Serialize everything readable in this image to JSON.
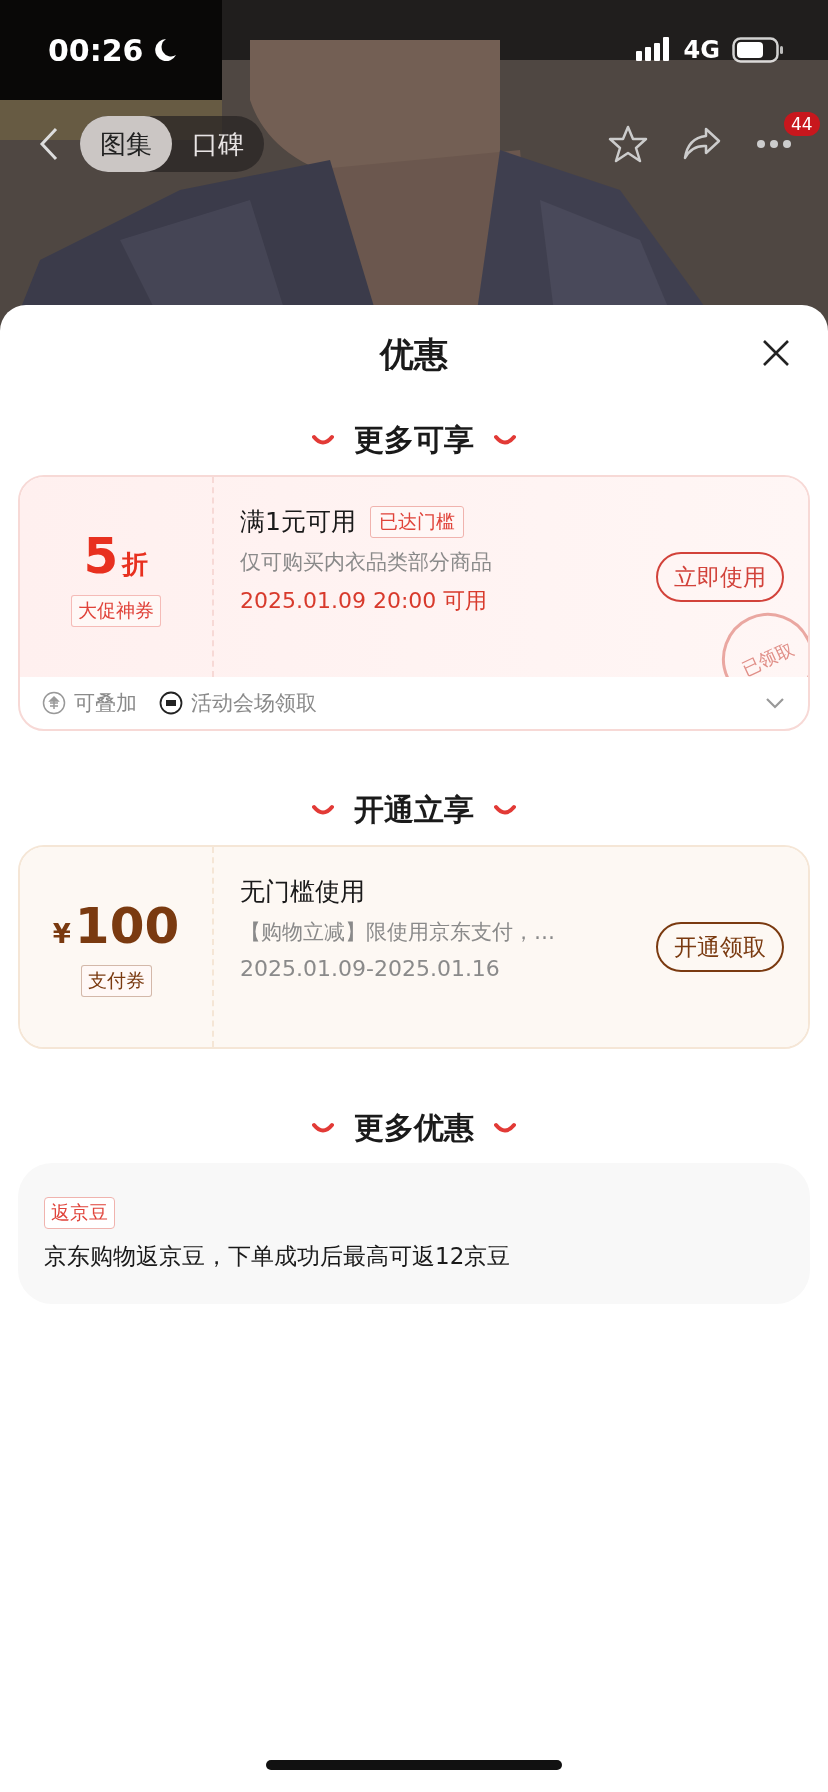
{
  "status_bar": {
    "time": "00:26",
    "network": "4G"
  },
  "nav": {
    "tabs": [
      {
        "label": "图集",
        "selected": true
      },
      {
        "label": "口碑",
        "selected": false
      }
    ],
    "more_badge": "44"
  },
  "sheet": {
    "title": "优惠",
    "sections": [
      {
        "title": "更多可享",
        "coupons": [
          {
            "kind": "discount",
            "amount": "5",
            "unit": "折",
            "tag": "大促神券",
            "title": "满1元可用",
            "badge": "已达门槛",
            "description": "仅可购买内衣品类部分商品",
            "date": "2025.01.09 20:00 可用",
            "button": "立即使用",
            "stamp": "已领取",
            "features": [
              {
                "kind": "stack",
                "text": "可叠加"
              },
              {
                "kind": "ticket",
                "text": "活动会场领取"
              }
            ],
            "expanded": false
          }
        ]
      },
      {
        "title": "开通立享",
        "coupons": [
          {
            "kind": "cash",
            "currency": "¥",
            "amount": "100",
            "tag": "支付券",
            "title": "无门槛使用",
            "description": "【购物立减】限使用京东支付，…",
            "date": "2025.01.09-2025.01.16",
            "button": "开通领取"
          }
        ]
      },
      {
        "title": "更多优惠",
        "offers": [
          {
            "tag": "返京豆",
            "text": "京东购物返京豆，下单成功后最高可返12京豆"
          }
        ]
      }
    ]
  }
}
